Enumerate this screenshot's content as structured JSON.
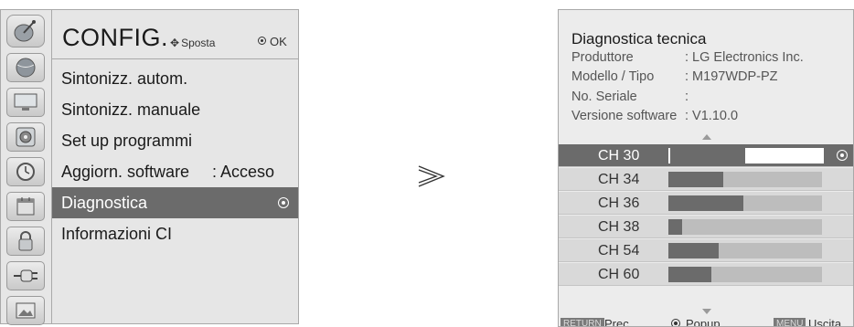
{
  "left_menu": {
    "title": "CONFIG.",
    "nav_hint": "Sposta",
    "ok_hint": "OK",
    "sidebar_icons": [
      "satellite-dish-icon",
      "monitor-icon",
      "speaker-icon",
      "clock-icon",
      "calendar-icon",
      "lock-icon",
      "plug-icon",
      "image-icon"
    ],
    "items": [
      {
        "label": "Sintonizz. autom."
      },
      {
        "label": "Sintonizz. manuale"
      },
      {
        "label": "Set up programmi"
      },
      {
        "label": "Aggiorn. software",
        "value": ": Acceso"
      },
      {
        "label": "Diagnostica",
        "selected": true
      },
      {
        "label": "Informazioni CI"
      }
    ]
  },
  "diagnostics": {
    "title": "Diagnostica tecnica",
    "info": [
      {
        "label": "Produttore",
        "value": ": LG Electronics Inc."
      },
      {
        "label": "Modello / Tipo",
        "value": ": M197WDP-PZ"
      },
      {
        "label": "No. Seriale",
        "value": ":"
      },
      {
        "label": "Versione software",
        "value": ": V1.10.0"
      }
    ],
    "channels": [
      {
        "name": "CH 30",
        "signal": 0.49,
        "selected": true
      },
      {
        "name": "CH 34",
        "signal": 0.36
      },
      {
        "name": "CH 36",
        "signal": 0.49
      },
      {
        "name": "CH 38",
        "signal": 0.09
      },
      {
        "name": "CH 54",
        "signal": 0.33
      },
      {
        "name": "CH 60",
        "signal": 0.28
      }
    ],
    "footer": {
      "return_key": "RETURN",
      "return_label": "Prec.",
      "popup_label": "Popup",
      "menu_key": "MENU",
      "menu_label": "Uscita"
    }
  }
}
